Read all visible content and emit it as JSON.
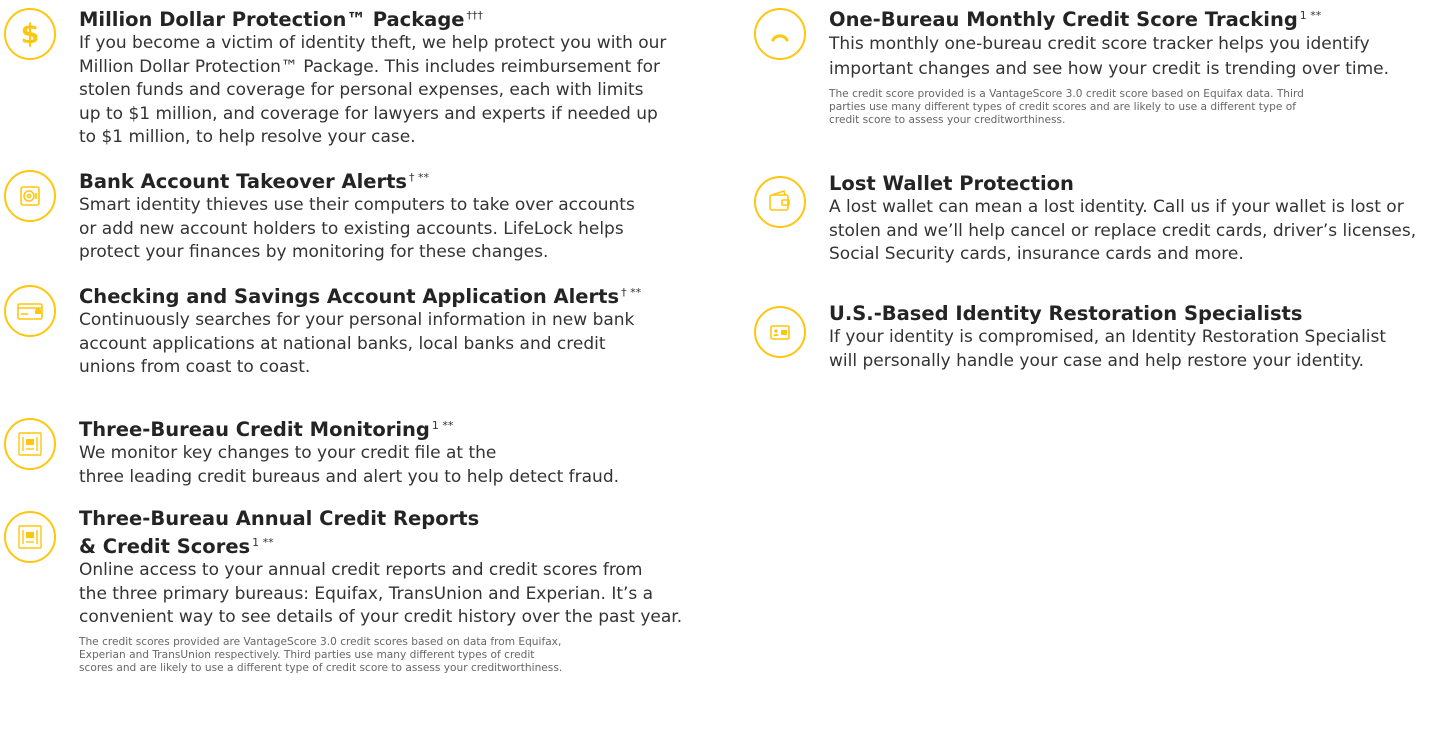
{
  "accent_color": "#ffc60f",
  "left_features": [
    {
      "icon": "dollar-icon",
      "title": "Million Dollar Protection™ Package",
      "sup": "†††",
      "lines": [
        "If you become a victim of identity theft, we help protect you with our",
        "Million Dollar Protection™ Package. This includes reimbursement for",
        "stolen funds and coverage for personal expenses, each with limits",
        "up to $1 million, and coverage for lawyers and experts if needed up",
        "to $1 million, to help resolve your case."
      ]
    },
    {
      "icon": "bank-vault-icon",
      "title": "Bank Account Takeover Alerts",
      "sup": "† **",
      "lines": [
        "Smart identity thieves use their computers to take over accounts",
        "or add new account holders to existing accounts. LifeLock helps",
        "protect your finances by monitoring for these changes."
      ]
    },
    {
      "icon": "card-alert-icon",
      "title": "Checking and Savings Account Application Alerts",
      "sup": "† **",
      "lines": [
        "Continuously searches for your personal information in new bank",
        "account applications at national banks, local banks and credit",
        "unions from coast to coast."
      ]
    },
    {
      "icon": "credit-report-icon",
      "title": "Three-Bureau Credit Monitoring",
      "sup": "1 **",
      "lines": [
        "We monitor key changes to your credit file at the",
        "three leading credit bureaus and alert you to help detect fraud."
      ]
    },
    {
      "icon": "credit-report-icon",
      "title_lines": [
        "Three-Bureau Annual Credit Reports",
        "& Credit Scores"
      ],
      "sup": "1 **",
      "lines": [
        "Online access to your annual credit reports and credit scores from",
        "the three primary bureaus: Equifax, TransUnion and Experian. It’s a",
        "convenient way to see details of your credit history over the past year."
      ],
      "fine_lines": [
        "The credit scores provided are VantageScore 3.0 credit scores based on data from Equifax,",
        "Experian and TransUnion respectively. Third parties use many different types of credit",
        "scores and are likely to use a different type of credit score to assess your creditworthiness."
      ]
    }
  ],
  "right_features": [
    {
      "icon": "gauge-icon",
      "title": "One-Bureau Monthly Credit Score Tracking",
      "sup": "1 **",
      "lines": [
        "This monthly one-bureau credit score tracker helps you identify",
        "important changes and see how your credit is trending over time."
      ],
      "fine_lines": [
        "The credit score provided is a VantageScore 3.0 credit score based on Equifax data. Third",
        "parties use many different types of credit scores and are likely to use a different type of",
        "credit score to assess your creditworthiness."
      ]
    },
    {
      "icon": "wallet-icon",
      "title": "Lost Wallet Protection",
      "lines": [
        "A lost wallet can mean a lost identity. Call us if your wallet is lost or",
        "stolen and we’ll help cancel or replace credit cards, driver’s licenses,",
        "Social Security cards, insurance cards and more."
      ]
    },
    {
      "icon": "id-card-icon",
      "title": "U.S.-Based Identity Restoration Specialists",
      "lines": [
        "If your identity is compromised, an Identity Restoration Specialist",
        "will personally handle your case and help restore your identity."
      ]
    }
  ]
}
